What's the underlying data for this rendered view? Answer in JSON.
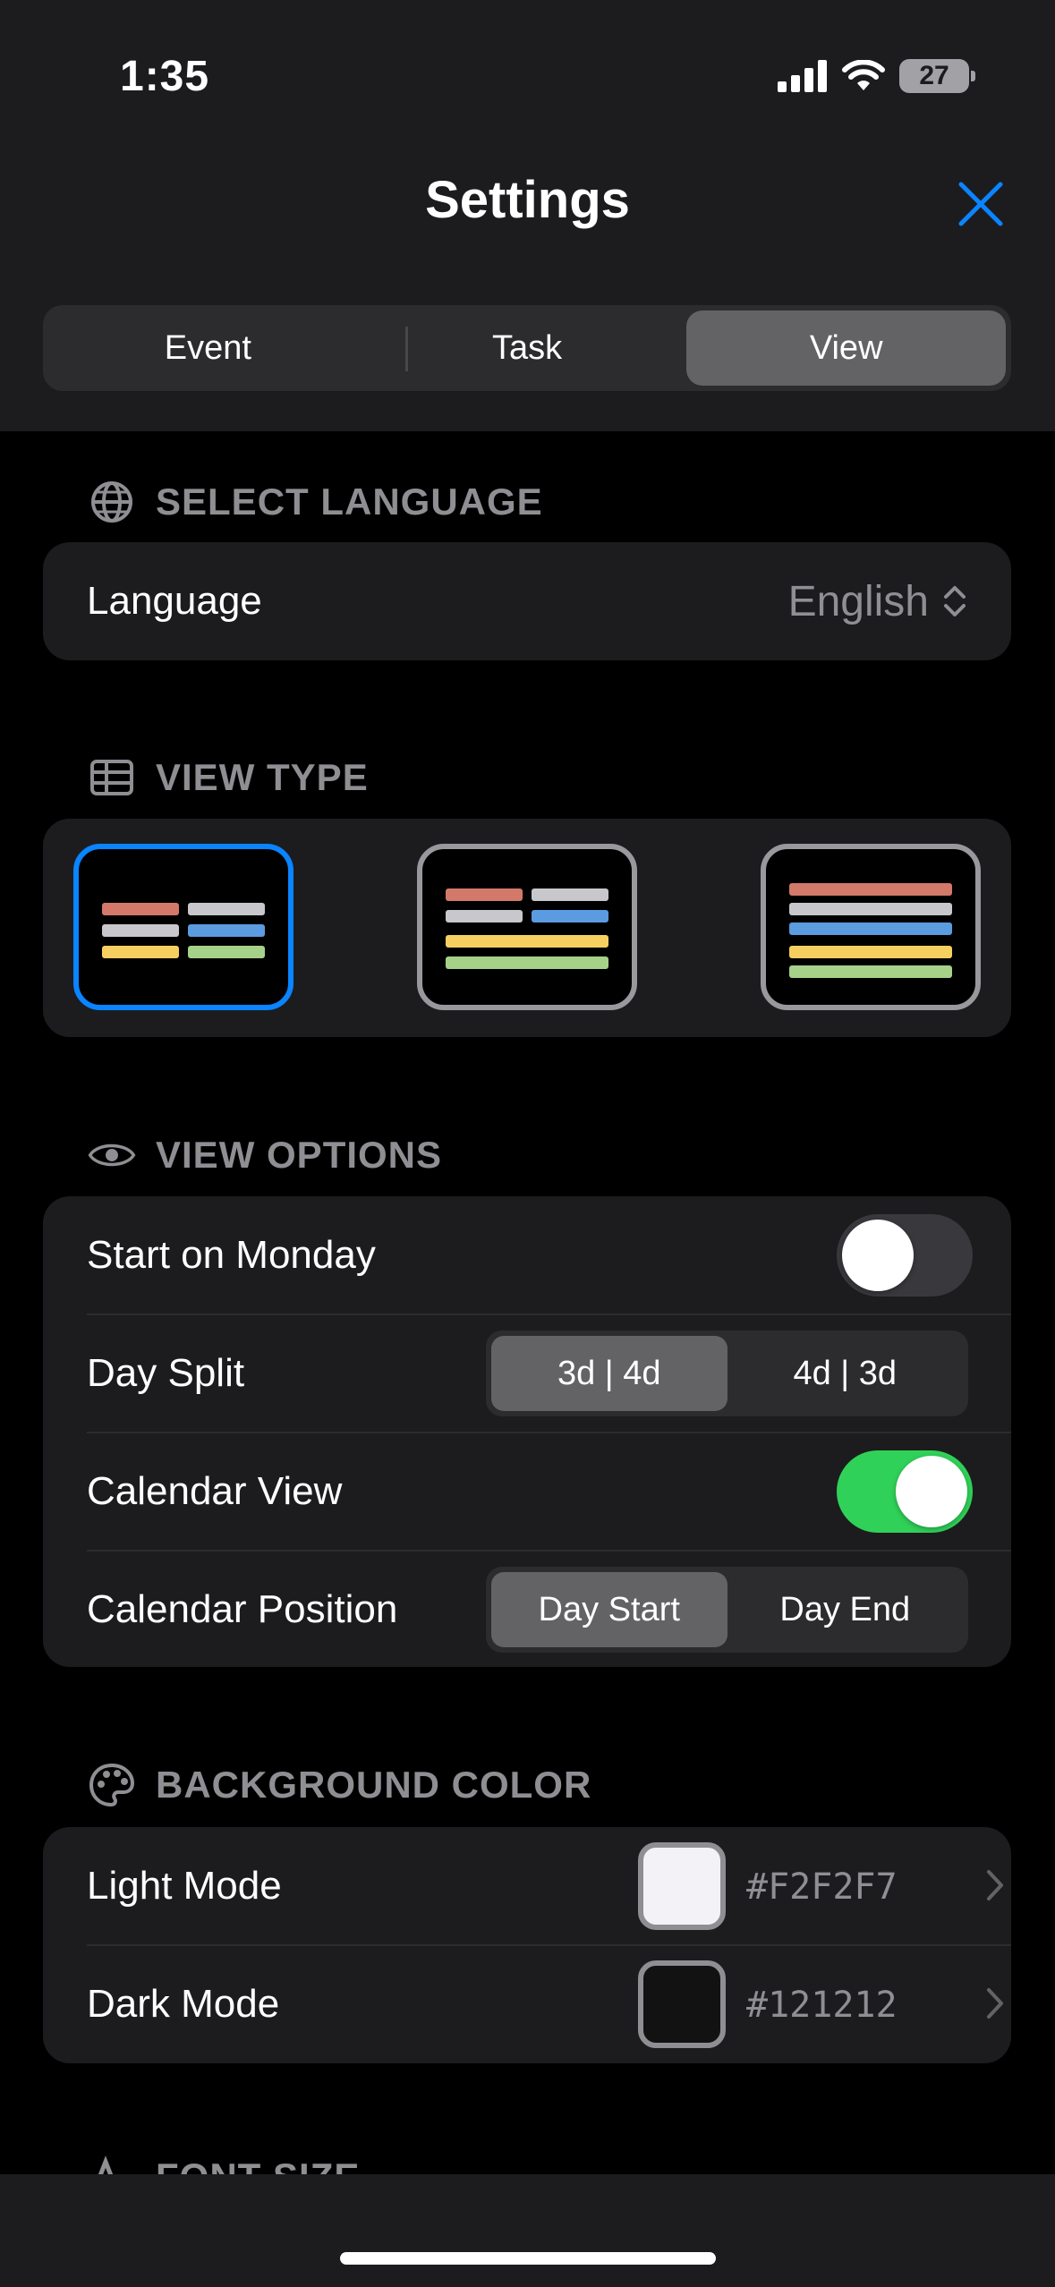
{
  "status_bar": {
    "time": "1:35",
    "battery": "27"
  },
  "header": {
    "title": "Settings"
  },
  "main_tabs": [
    {
      "label": "Event",
      "active": false
    },
    {
      "label": "Task",
      "active": false
    },
    {
      "label": "View",
      "active": true
    }
  ],
  "language_section": {
    "heading": "SELECT LANGUAGE",
    "row_label": "Language",
    "value": "English"
  },
  "view_type_section": {
    "heading": "VIEW TYPE",
    "selected_index": 0
  },
  "view_options_section": {
    "heading": "VIEW OPTIONS",
    "start_on_monday": {
      "label": "Start on Monday",
      "enabled": false
    },
    "day_split": {
      "label": "Day Split",
      "options": [
        "3d | 4d",
        "4d | 3d"
      ],
      "selected": "3d | 4d"
    },
    "calendar_view": {
      "label": "Calendar View",
      "enabled": true
    },
    "calendar_position": {
      "label": "Calendar Position",
      "options": [
        "Day Start",
        "Day End"
      ],
      "selected": "Day Start"
    }
  },
  "background_color_section": {
    "heading": "BACKGROUND COLOR",
    "light_mode": {
      "label": "Light Mode",
      "hex": "#F2F2F7",
      "color": "#F2F2F7"
    },
    "dark_mode": {
      "label": "Dark Mode",
      "hex": "#121212",
      "color": "#121212"
    }
  },
  "font_size_section": {
    "heading": "FONT SIZE"
  },
  "colors": {
    "accent": "#0A84FF",
    "toggle_on": "#30D158",
    "bar_red": "#D2796A",
    "bar_gray": "#C7C7CC",
    "bar_blue": "#5B9BE0",
    "bar_yellow": "#F5D060",
    "bar_green": "#A6D189"
  }
}
